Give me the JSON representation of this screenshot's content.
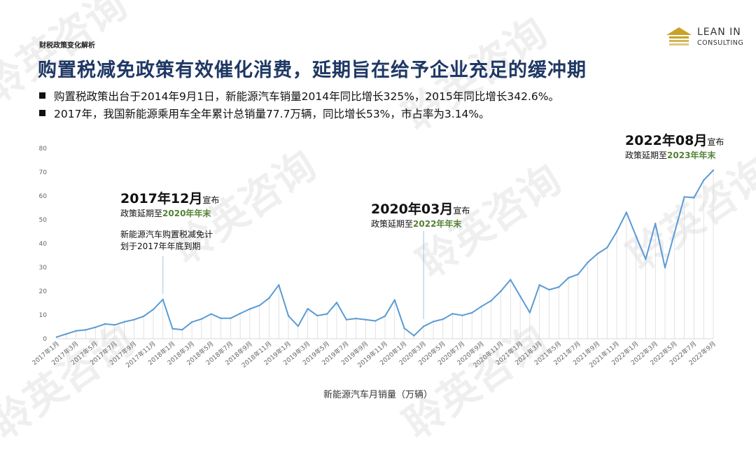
{
  "section_label": "财税政策变化解析",
  "headline": "购置税减免政策有效催化消费，延期旨在给予企业充足的缓冲期",
  "bullets": [
    "购置税政策出台于2014年9月1日，新能源汽车销量2014年同比增长325%，2015年同比增长342.6%。",
    "2017年，我国新能源乘用车全年累计总销量77.7万辆，同比增长53%，市占率为3.14%。"
  ],
  "logo": {
    "line1": "LEAN IN",
    "line2": "CONSULTING",
    "accent_color": "#c9a227"
  },
  "watermark": "聆英咨询",
  "annotations": [
    {
      "title": "2017年12月",
      "suffix": "宣布",
      "line_prefix": "政策延期至",
      "line_highlight": "2020年年末",
      "note1": "新能源汽车购置税减免计",
      "note2": "划于2017年年底到期"
    },
    {
      "title": "2020年03月",
      "suffix": "宣布",
      "line_prefix": "政策延期至",
      "line_highlight": "2022年年末"
    },
    {
      "title": "2022年08月",
      "suffix": "宣布",
      "line_prefix": "政策延期至",
      "line_highlight": "2023年年末"
    }
  ],
  "colors": {
    "line": "#5b9bd5",
    "headline": "#1f3864",
    "highlight": "#548235"
  },
  "chart_data": {
    "type": "line",
    "title": "",
    "xlabel": "新能源汽车月销量（万辆）",
    "ylabel": "",
    "ylim": [
      0,
      80
    ],
    "yticks": [
      0,
      10,
      20,
      30,
      40,
      50,
      60,
      70,
      80
    ],
    "grid": false,
    "x": [
      "2017年1月",
      "2017年2月",
      "2017年3月",
      "2017年4月",
      "2017年5月",
      "2017年6月",
      "2017年7月",
      "2017年8月",
      "2017年9月",
      "2017年10月",
      "2017年11月",
      "2017年12月",
      "2018年1月",
      "2018年2月",
      "2018年3月",
      "2018年4月",
      "2018年5月",
      "2018年6月",
      "2018年7月",
      "2018年8月",
      "2018年9月",
      "2018年10月",
      "2018年11月",
      "2018年12月",
      "2019年1月",
      "2019年2月",
      "2019年3月",
      "2019年4月",
      "2019年5月",
      "2019年6月",
      "2019年7月",
      "2019年8月",
      "2019年9月",
      "2019年10月",
      "2019年11月",
      "2019年12月",
      "2020年1月",
      "2020年2月",
      "2020年3月",
      "2020年4月",
      "2020年5月",
      "2020年6月",
      "2020年7月",
      "2020年8月",
      "2020年9月",
      "2020年10月",
      "2020年11月",
      "2020年12月",
      "2021年1月",
      "2021年2月",
      "2021年3月",
      "2021年4月",
      "2021年5月",
      "2021年6月",
      "2021年7月",
      "2021年8月",
      "2021年9月",
      "2021年10月",
      "2021年11月",
      "2021年12月",
      "2022年1月",
      "2022年2月",
      "2022年3月",
      "2022年4月",
      "2022年5月",
      "2022年6月",
      "2022年7月",
      "2022年8月",
      "2022年9月"
    ],
    "xticks_shown": [
      "2017年1月",
      "2017年3月",
      "2017年5月",
      "2017年7月",
      "2017年9月",
      "2017年11月",
      "2018年1月",
      "2018年3月",
      "2018年5月",
      "2018年7月",
      "2018年9月",
      "2018年11月",
      "2019年1月",
      "2019年3月",
      "2019年5月",
      "2019年7月",
      "2019年9月",
      "2019年11月",
      "2020年1月",
      "2020年3月",
      "2020年5月",
      "2020年7月",
      "2020年9月",
      "2020年11月",
      "2021年1月",
      "2021年3月",
      "2021年5月",
      "2021年7月",
      "2021年9月",
      "2021年11月",
      "2022年1月",
      "2022年3月",
      "2022年5月",
      "2022年7月",
      "2022年9月"
    ],
    "series": [
      {
        "values": [
          0.7,
          2.0,
          3.3,
          3.7,
          4.8,
          6.2,
          5.8,
          7.1,
          8.0,
          9.4,
          12.3,
          16.5,
          4.2,
          3.8,
          7.0,
          8.3,
          10.4,
          8.6,
          8.6,
          10.6,
          12.5,
          14.0,
          17.1,
          22.6,
          9.6,
          5.3,
          12.6,
          9.7,
          10.4,
          15.2,
          8.0,
          8.5,
          8.0,
          7.5,
          9.5,
          16.3,
          4.4,
          1.3,
          5.2,
          7.2,
          8.2,
          10.5,
          9.8,
          10.9,
          13.6,
          16.0,
          20.0,
          24.8,
          17.9,
          11.0,
          22.6,
          20.6,
          21.7,
          25.6,
          27.1,
          32.1,
          35.7,
          38.3,
          45.0,
          53.1,
          43.1,
          33.4,
          48.4,
          29.9,
          44.7,
          59.6,
          59.3,
          66.6,
          70.8
        ]
      }
    ],
    "markers": [
      {
        "x": "2017年12月",
        "kind": "policy-extension"
      },
      {
        "x": "2020年3月",
        "kind": "policy-extension"
      },
      {
        "x": "2022年8月",
        "kind": "policy-extension"
      }
    ]
  }
}
